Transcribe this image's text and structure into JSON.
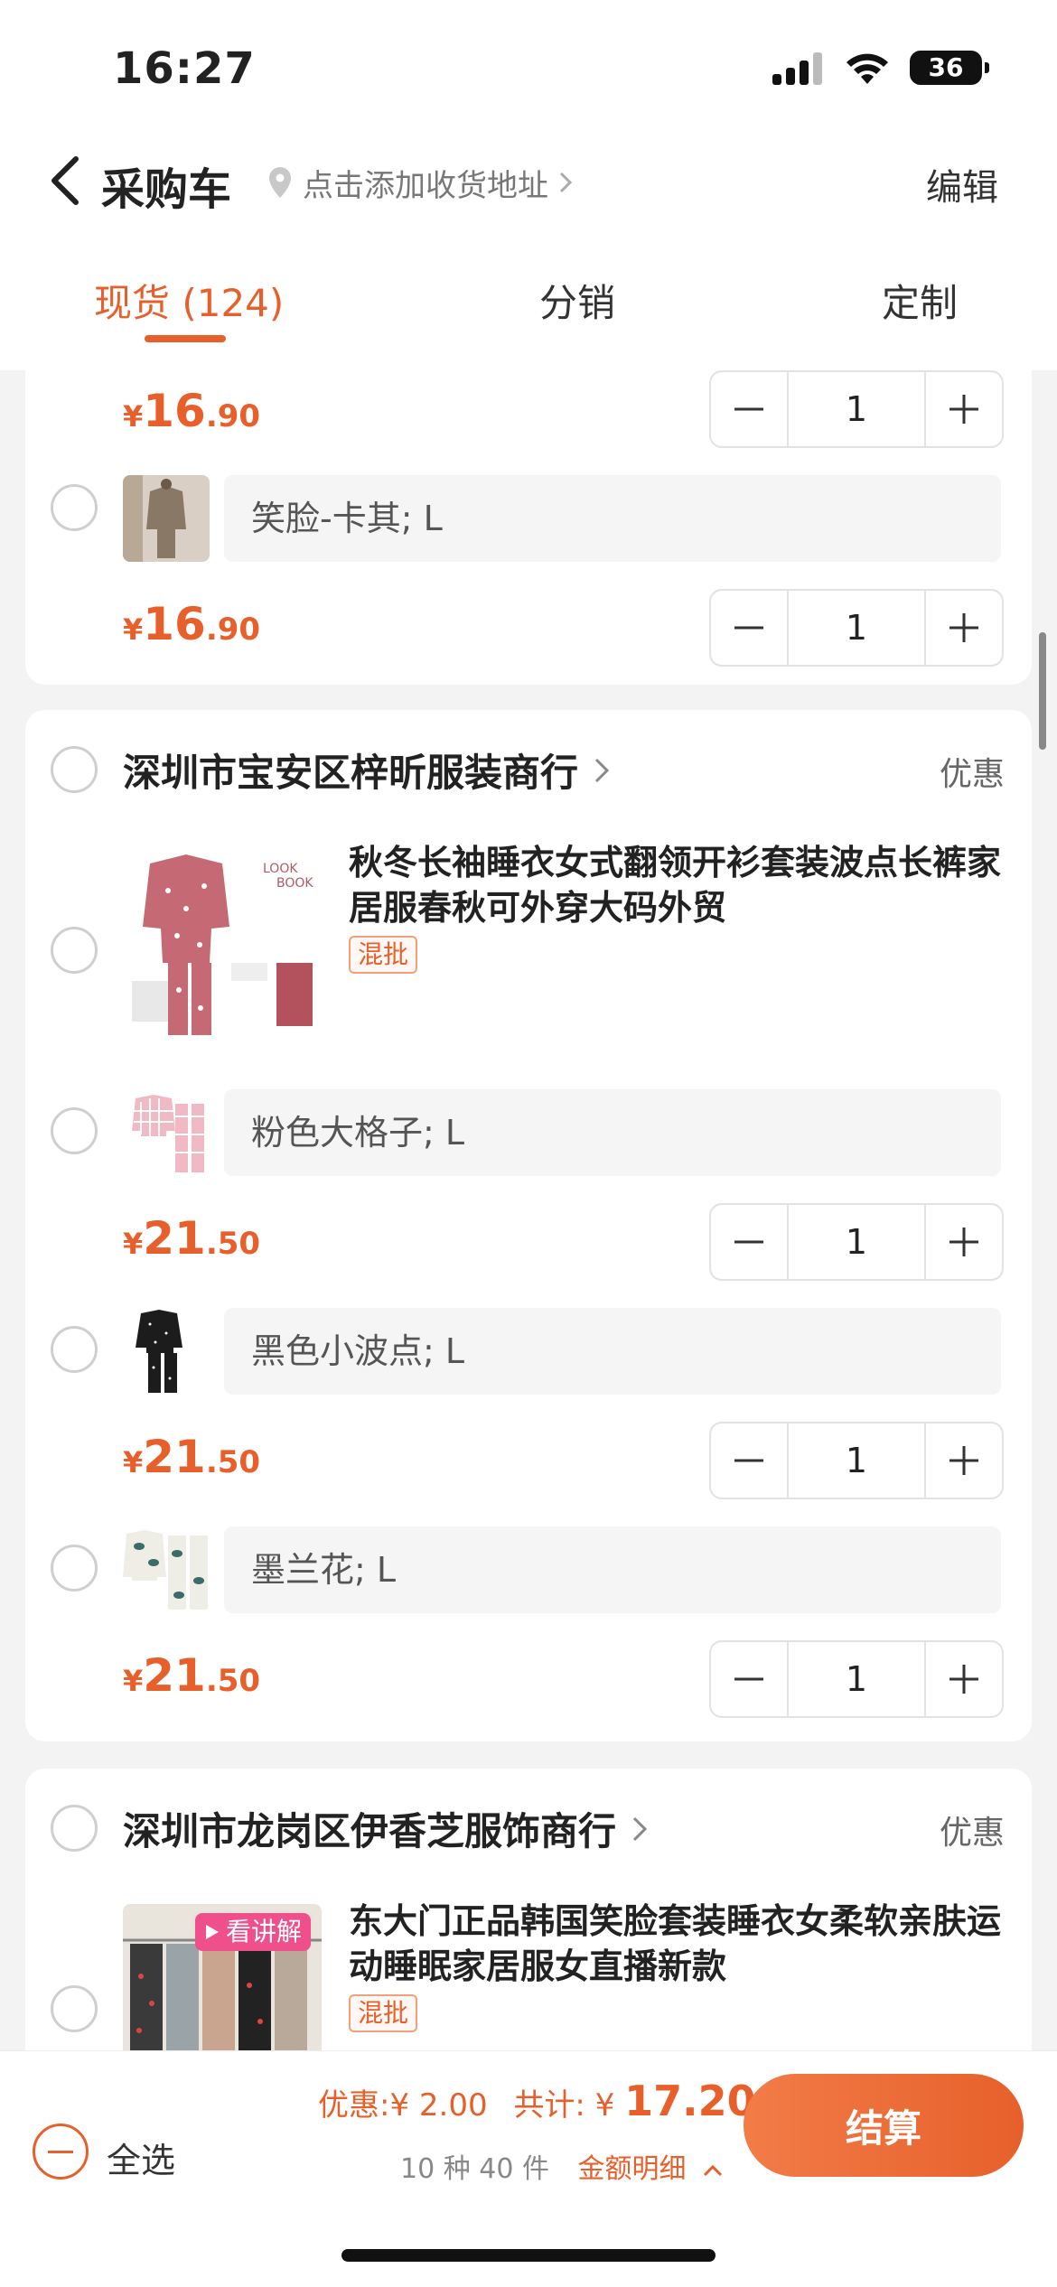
{
  "status_bar": {
    "time": "16:27",
    "battery": "36"
  },
  "nav": {
    "title": "采购车",
    "address_prompt": "点击添加收货地址",
    "edit_label": "编辑"
  },
  "tabs": [
    {
      "label": "现货 (124)",
      "active": true
    },
    {
      "label": "分销",
      "active": false
    },
    {
      "label": "定制",
      "active": false
    }
  ],
  "card1": {
    "partial_price": {
      "cur": "¥",
      "int": "16",
      "dec": ".90"
    },
    "partial_qty": "1",
    "items": [
      {
        "variant": "笑脸-卡其; L",
        "price": {
          "cur": "¥",
          "int": "16",
          "dec": ".90"
        },
        "qty": "1"
      }
    ]
  },
  "shop1": {
    "name": "深圳市宝安区梓昕服装商行",
    "promo": "优惠",
    "product_title": "秋冬长袖睡衣女式翻领开衫套装波点长裤家居服春秋可外穿大码外贸",
    "tag": "混批",
    "items": [
      {
        "variant": "粉色大格子; L",
        "price": {
          "cur": "¥",
          "int": "21",
          "dec": ".50"
        },
        "qty": "1"
      },
      {
        "variant": "黑色小波点; L",
        "price": {
          "cur": "¥",
          "int": "21",
          "dec": ".50"
        },
        "qty": "1"
      },
      {
        "variant": "墨兰花; L",
        "price": {
          "cur": "¥",
          "int": "21",
          "dec": ".50"
        },
        "qty": "1"
      }
    ]
  },
  "shop2": {
    "name": "深圳市龙岗区伊香芝服饰商行",
    "promo": "优惠",
    "live_badge": "看讲解",
    "product_title": "东大门正品韩国笑脸套装睡衣女柔软亲肤运动睡眠家居服女直播新款",
    "tag": "混批"
  },
  "thumb_text": {
    "look": "LOOK",
    "book": "BOOK"
  },
  "bottom": {
    "select_all": "全选",
    "discount_label": "优惠:",
    "discount_value": "¥ 2.00",
    "total_label": "共计:",
    "total_cur": "¥",
    "total_value": "17.20",
    "count": "10 种 40 件",
    "details": "金额明细",
    "checkout": "结算"
  },
  "colors": {
    "accent": "#e7602b",
    "background": "#f3f3f3"
  }
}
